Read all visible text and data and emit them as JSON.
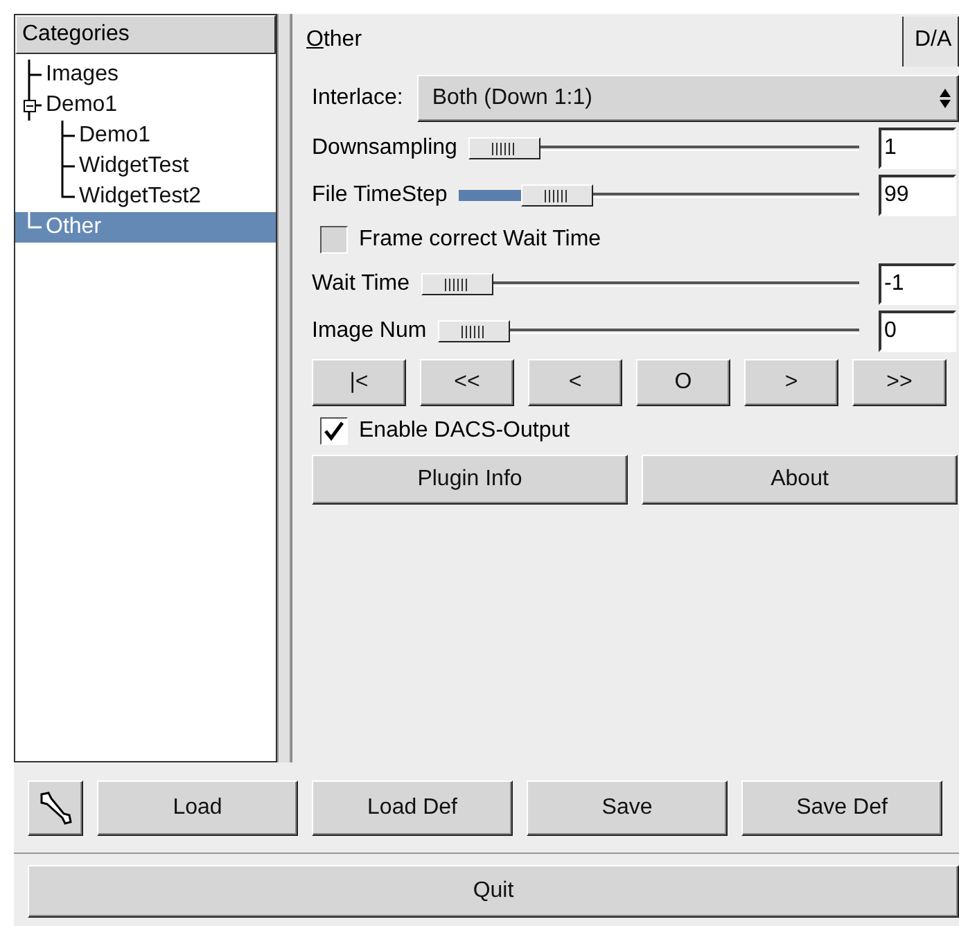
{
  "sidebar": {
    "header": "Categories",
    "tree": [
      {
        "label": "Images",
        "selected": false
      },
      {
        "label": "Demo1",
        "selected": false,
        "expanded": true,
        "children": [
          {
            "label": "Demo1",
            "selected": false
          },
          {
            "label": "WidgetTest",
            "selected": false
          },
          {
            "label": "WidgetTest2",
            "selected": false
          }
        ]
      },
      {
        "label": "Other",
        "selected": true
      }
    ]
  },
  "tabs": [
    {
      "label": "Other",
      "mnemonic": true,
      "selected": true
    },
    {
      "label": "D/A",
      "selected": false
    }
  ],
  "interlace": {
    "label": "Interlace:",
    "value": "Both (Down 1:1)"
  },
  "sliders": [
    {
      "label": "Downsampling",
      "level": 0,
      "value": "1"
    },
    {
      "label": "File TimeStep",
      "level": 0.19,
      "value": "99"
    }
  ],
  "frame_correct": {
    "label": "Frame correct Wait Time",
    "checked": false
  },
  "sliders2": [
    {
      "label": "Wait Time",
      "level": 0,
      "value": "-1"
    },
    {
      "label": "Image Num",
      "level": 0,
      "value": "0"
    }
  ],
  "nav_buttons": [
    "|<",
    "<<",
    "<",
    "O",
    ">",
    ">>"
  ],
  "enable_dacs": {
    "label": "Enable DACS-Output",
    "checked": true
  },
  "info_buttons": [
    "Plugin Info",
    "About"
  ],
  "bottom_buttons": [
    "Load",
    "Load Def",
    "Save",
    "Save Def"
  ],
  "quit": "Quit"
}
